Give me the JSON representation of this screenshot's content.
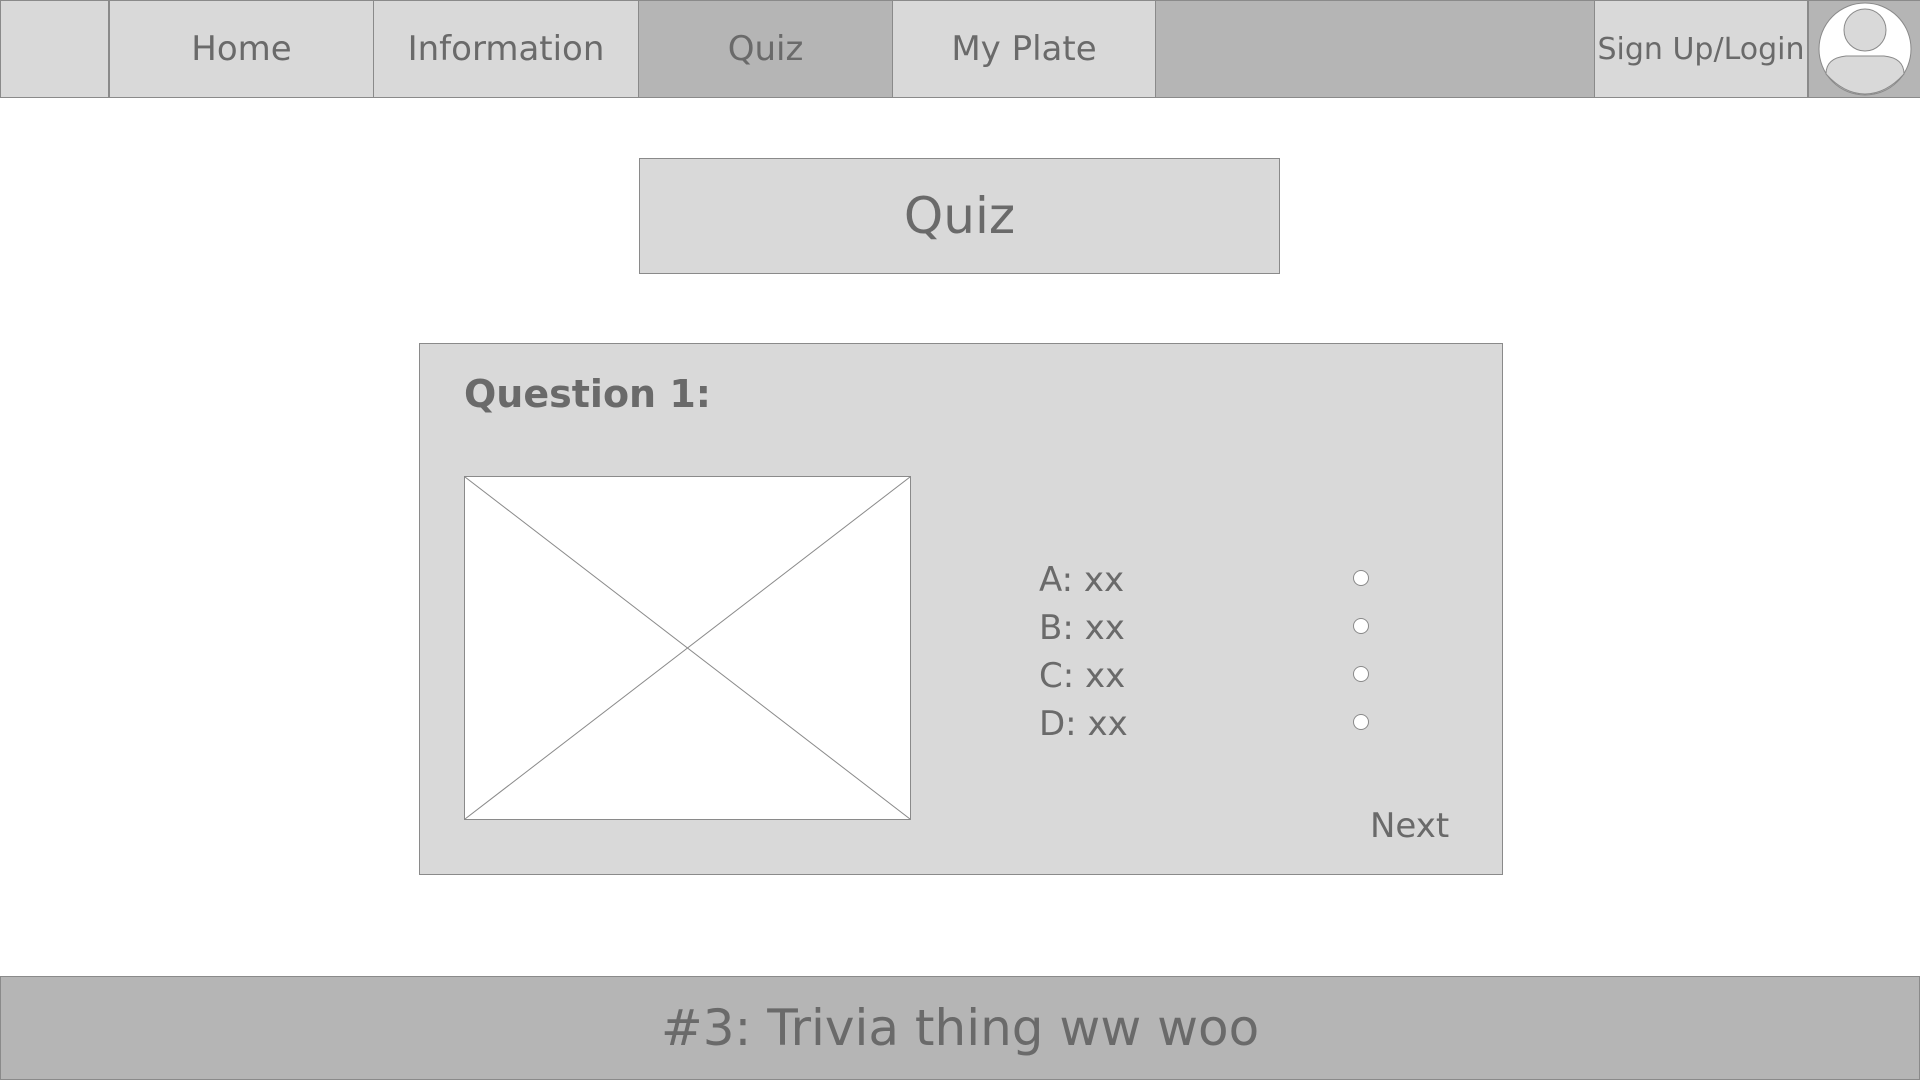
{
  "nav": {
    "items": [
      {
        "label": ""
      },
      {
        "label": "Home"
      },
      {
        "label": "Information"
      },
      {
        "label": "Quiz"
      },
      {
        "label": "My Plate"
      }
    ],
    "login_label": "Sign Up/Login",
    "active_item": "Quiz",
    "avatar_icon": "user-avatar-icon"
  },
  "page": {
    "title": "Quiz"
  },
  "quiz": {
    "question_label": "Question 1:",
    "image_icon": "image-placeholder-icon",
    "answers": [
      {
        "label": "A: xx",
        "selected": false
      },
      {
        "label": "B: xx",
        "selected": false
      },
      {
        "label": "C: xx",
        "selected": false
      },
      {
        "label": "D: xx",
        "selected": false
      }
    ],
    "next_label": "Next"
  },
  "footer": {
    "text": "#3: Trivia thing ww woo"
  },
  "colors": {
    "panel": "#d9d9d9",
    "bar": "#b5b5b5",
    "border": "#8a8a8a",
    "text": "#6a6a6a",
    "background": "#ffffff"
  }
}
